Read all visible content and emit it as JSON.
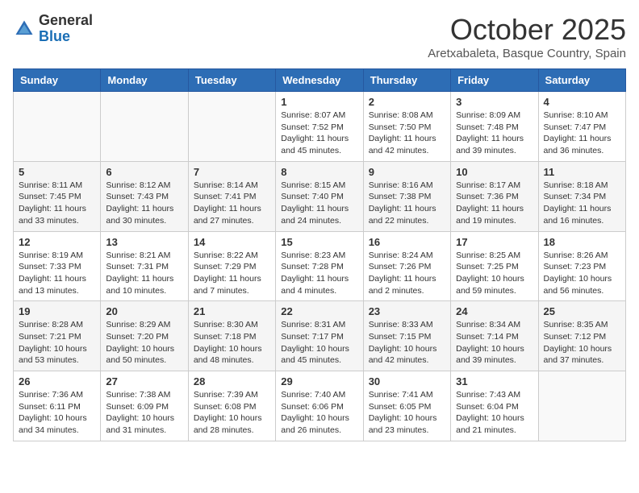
{
  "header": {
    "logo_general": "General",
    "logo_blue": "Blue",
    "month_title": "October 2025",
    "location": "Aretxabaleta, Basque Country, Spain"
  },
  "days_of_week": [
    "Sunday",
    "Monday",
    "Tuesday",
    "Wednesday",
    "Thursday",
    "Friday",
    "Saturday"
  ],
  "weeks": [
    [
      {
        "day": "",
        "info": ""
      },
      {
        "day": "",
        "info": ""
      },
      {
        "day": "",
        "info": ""
      },
      {
        "day": "1",
        "info": "Sunrise: 8:07 AM\nSunset: 7:52 PM\nDaylight: 11 hours and 45 minutes."
      },
      {
        "day": "2",
        "info": "Sunrise: 8:08 AM\nSunset: 7:50 PM\nDaylight: 11 hours and 42 minutes."
      },
      {
        "day": "3",
        "info": "Sunrise: 8:09 AM\nSunset: 7:48 PM\nDaylight: 11 hours and 39 minutes."
      },
      {
        "day": "4",
        "info": "Sunrise: 8:10 AM\nSunset: 7:47 PM\nDaylight: 11 hours and 36 minutes."
      }
    ],
    [
      {
        "day": "5",
        "info": "Sunrise: 8:11 AM\nSunset: 7:45 PM\nDaylight: 11 hours and 33 minutes."
      },
      {
        "day": "6",
        "info": "Sunrise: 8:12 AM\nSunset: 7:43 PM\nDaylight: 11 hours and 30 minutes."
      },
      {
        "day": "7",
        "info": "Sunrise: 8:14 AM\nSunset: 7:41 PM\nDaylight: 11 hours and 27 minutes."
      },
      {
        "day": "8",
        "info": "Sunrise: 8:15 AM\nSunset: 7:40 PM\nDaylight: 11 hours and 24 minutes."
      },
      {
        "day": "9",
        "info": "Sunrise: 8:16 AM\nSunset: 7:38 PM\nDaylight: 11 hours and 22 minutes."
      },
      {
        "day": "10",
        "info": "Sunrise: 8:17 AM\nSunset: 7:36 PM\nDaylight: 11 hours and 19 minutes."
      },
      {
        "day": "11",
        "info": "Sunrise: 8:18 AM\nSunset: 7:34 PM\nDaylight: 11 hours and 16 minutes."
      }
    ],
    [
      {
        "day": "12",
        "info": "Sunrise: 8:19 AM\nSunset: 7:33 PM\nDaylight: 11 hours and 13 minutes."
      },
      {
        "day": "13",
        "info": "Sunrise: 8:21 AM\nSunset: 7:31 PM\nDaylight: 11 hours and 10 minutes."
      },
      {
        "day": "14",
        "info": "Sunrise: 8:22 AM\nSunset: 7:29 PM\nDaylight: 11 hours and 7 minutes."
      },
      {
        "day": "15",
        "info": "Sunrise: 8:23 AM\nSunset: 7:28 PM\nDaylight: 11 hours and 4 minutes."
      },
      {
        "day": "16",
        "info": "Sunrise: 8:24 AM\nSunset: 7:26 PM\nDaylight: 11 hours and 2 minutes."
      },
      {
        "day": "17",
        "info": "Sunrise: 8:25 AM\nSunset: 7:25 PM\nDaylight: 10 hours and 59 minutes."
      },
      {
        "day": "18",
        "info": "Sunrise: 8:26 AM\nSunset: 7:23 PM\nDaylight: 10 hours and 56 minutes."
      }
    ],
    [
      {
        "day": "19",
        "info": "Sunrise: 8:28 AM\nSunset: 7:21 PM\nDaylight: 10 hours and 53 minutes."
      },
      {
        "day": "20",
        "info": "Sunrise: 8:29 AM\nSunset: 7:20 PM\nDaylight: 10 hours and 50 minutes."
      },
      {
        "day": "21",
        "info": "Sunrise: 8:30 AM\nSunset: 7:18 PM\nDaylight: 10 hours and 48 minutes."
      },
      {
        "day": "22",
        "info": "Sunrise: 8:31 AM\nSunset: 7:17 PM\nDaylight: 10 hours and 45 minutes."
      },
      {
        "day": "23",
        "info": "Sunrise: 8:33 AM\nSunset: 7:15 PM\nDaylight: 10 hours and 42 minutes."
      },
      {
        "day": "24",
        "info": "Sunrise: 8:34 AM\nSunset: 7:14 PM\nDaylight: 10 hours and 39 minutes."
      },
      {
        "day": "25",
        "info": "Sunrise: 8:35 AM\nSunset: 7:12 PM\nDaylight: 10 hours and 37 minutes."
      }
    ],
    [
      {
        "day": "26",
        "info": "Sunrise: 7:36 AM\nSunset: 6:11 PM\nDaylight: 10 hours and 34 minutes."
      },
      {
        "day": "27",
        "info": "Sunrise: 7:38 AM\nSunset: 6:09 PM\nDaylight: 10 hours and 31 minutes."
      },
      {
        "day": "28",
        "info": "Sunrise: 7:39 AM\nSunset: 6:08 PM\nDaylight: 10 hours and 28 minutes."
      },
      {
        "day": "29",
        "info": "Sunrise: 7:40 AM\nSunset: 6:06 PM\nDaylight: 10 hours and 26 minutes."
      },
      {
        "day": "30",
        "info": "Sunrise: 7:41 AM\nSunset: 6:05 PM\nDaylight: 10 hours and 23 minutes."
      },
      {
        "day": "31",
        "info": "Sunrise: 7:43 AM\nSunset: 6:04 PM\nDaylight: 10 hours and 21 minutes."
      },
      {
        "day": "",
        "info": ""
      }
    ]
  ]
}
